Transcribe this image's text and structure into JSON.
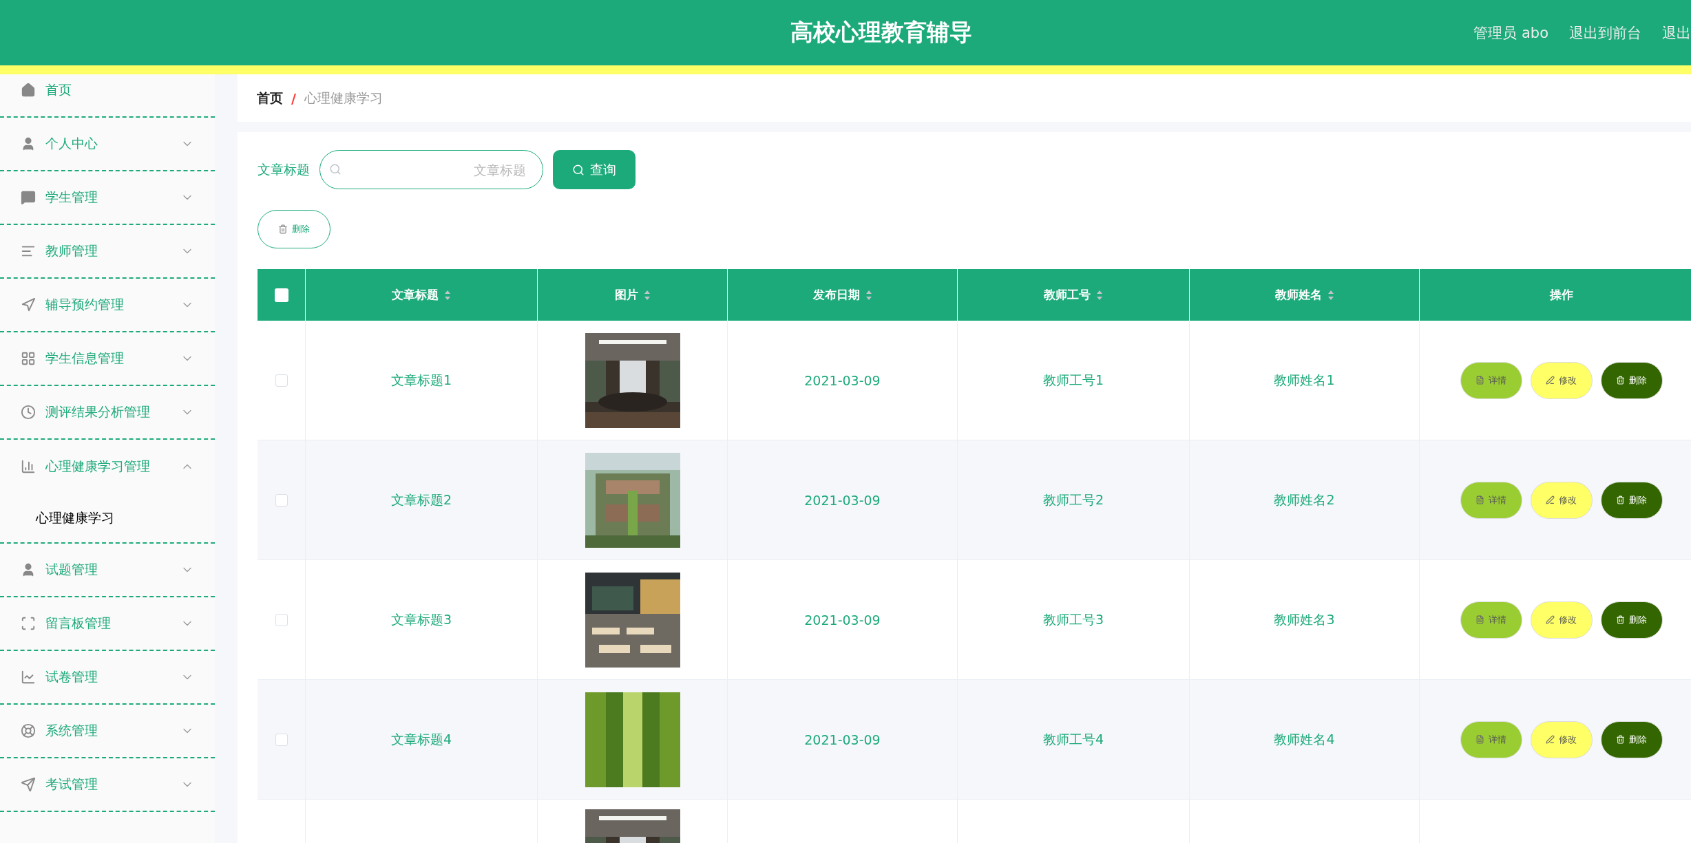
{
  "header": {
    "title": "高校心理教育辅导",
    "links": [
      "管理员 abo",
      "退出到前台",
      "退出"
    ]
  },
  "sidebar": {
    "items": [
      {
        "label": "首页"
      },
      {
        "label": "个人中心",
        "expanded": false
      },
      {
        "label": "学生管理",
        "expanded": false
      },
      {
        "label": "教师管理",
        "expanded": false
      },
      {
        "label": "辅导预约管理",
        "expanded": false
      },
      {
        "label": "学生信息管理",
        "expanded": false
      },
      {
        "label": "测评结果分析管理",
        "expanded": false
      },
      {
        "label": "心理健康学习管理",
        "expanded": true,
        "children": [
          {
            "label": "心理健康学习",
            "selected": true
          }
        ]
      },
      {
        "label": "试题管理",
        "expanded": false
      },
      {
        "label": "留言板管理",
        "expanded": false
      },
      {
        "label": "试卷管理",
        "expanded": false
      },
      {
        "label": "系统管理",
        "expanded": false
      },
      {
        "label": "考试管理",
        "expanded": false
      }
    ]
  },
  "breadcrumb": {
    "items": [
      "首页",
      "心理健康学习"
    ],
    "separator": "/"
  },
  "search": {
    "label": "文章标题",
    "placeholder": "文章标题",
    "button": "查询"
  },
  "delete_button": "删除",
  "table": {
    "header_checked": false,
    "columns": [
      "文章标题",
      "图片",
      "发布日期",
      "教师工号",
      "教师姓名",
      "操作"
    ],
    "rows": [
      {
        "checked": false,
        "title": "文章标题1",
        "picture": {
          "kind": "picture"
        },
        "date": "2021-03-09",
        "teacher_id": "教师工号1",
        "teacher_name": "教师姓名1",
        "actions": [
          "详情",
          "修改",
          "删除"
        ]
      },
      {
        "checked": false,
        "title": "文章标题2",
        "picture": {
          "kind": "picture"
        },
        "date": "2021-03-09",
        "teacher_id": "教师工号2",
        "teacher_name": "教师姓名2",
        "actions": [
          "详情",
          "修改",
          "删除"
        ]
      },
      {
        "checked": false,
        "title": "文章标题3",
        "picture": {
          "kind": "picture"
        },
        "date": "2021-03-09",
        "teacher_id": "教师工号3",
        "teacher_name": "教师姓名3",
        "actions": [
          "详情",
          "修改",
          "删除"
        ]
      },
      {
        "checked": false,
        "title": "文章标题4",
        "picture": {
          "kind": "picture"
        },
        "date": "2021-03-09",
        "teacher_id": "教师工号4",
        "teacher_name": "教师姓名4",
        "actions": [
          "详情",
          "修改",
          "删除"
        ]
      },
      {
        "picture": {
          "kind": "picture"
        }
      }
    ]
  }
}
